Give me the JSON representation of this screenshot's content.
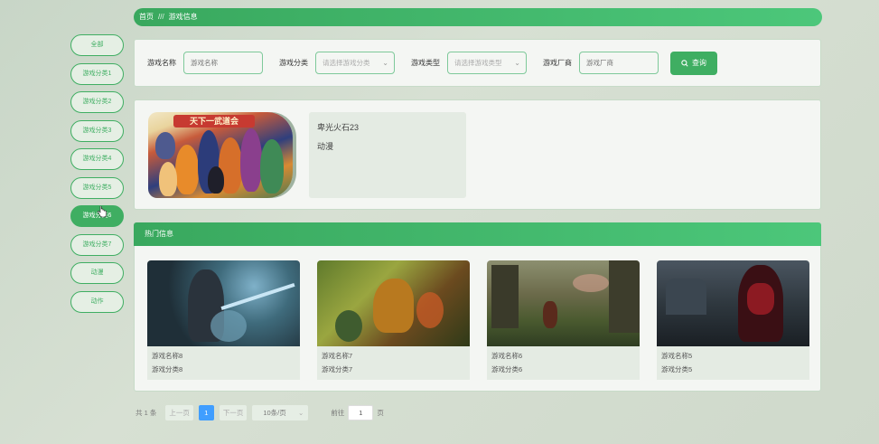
{
  "sidebar": {
    "items": [
      {
        "label": "全部"
      },
      {
        "label": "游戏分类1"
      },
      {
        "label": "游戏分类2"
      },
      {
        "label": "游戏分类3"
      },
      {
        "label": "游戏分类4"
      },
      {
        "label": "游戏分类5"
      },
      {
        "label": "游戏分类6",
        "active": true
      },
      {
        "label": "游戏分类7"
      },
      {
        "label": "动漫"
      },
      {
        "label": "动作"
      }
    ]
  },
  "breadcrumb": {
    "home": "首页",
    "separator": "///",
    "current": "游戏信息"
  },
  "search": {
    "name_label": "游戏名称",
    "name_placeholder": "游戏名称",
    "category_label": "游戏分类",
    "category_placeholder": "请选择游戏分类",
    "type_label": "游戏类型",
    "type_placeholder": "请选择游戏类型",
    "vendor_label": "游戏厂商",
    "vendor_placeholder": "游戏厂商",
    "query_label": "查询"
  },
  "detail": {
    "banner_text": "天下一武道会",
    "name": "卑光火石23",
    "category": "动漫"
  },
  "hot": {
    "title": "热门信息",
    "cards": [
      {
        "name": "游戏名称8",
        "category": "游戏分类8"
      },
      {
        "name": "游戏名称7",
        "category": "游戏分类7"
      },
      {
        "name": "游戏名称6",
        "category": "游戏分类6"
      },
      {
        "name": "游戏名称5",
        "category": "游戏分类5"
      }
    ]
  },
  "pagination": {
    "total": "共 1 条",
    "prev": "上一页",
    "current": "1",
    "next": "下一页",
    "page_size": "10条/页",
    "goto_label": "前往",
    "goto_value": "1",
    "page_suffix": "页"
  },
  "colors": {
    "accent": "#3fae62",
    "page_blue": "#409eff"
  }
}
